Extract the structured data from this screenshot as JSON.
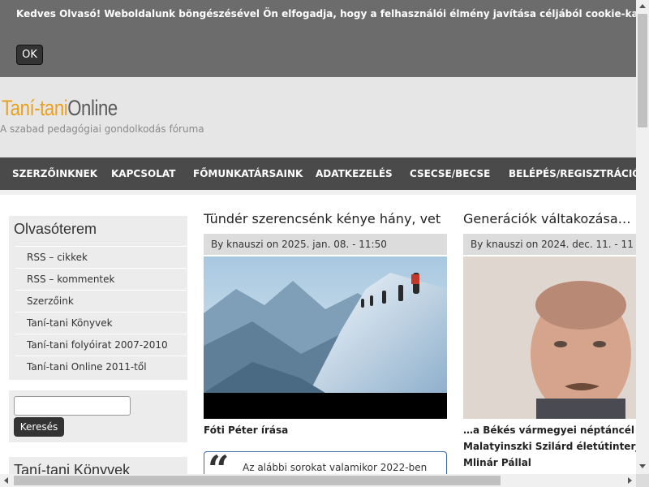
{
  "cookie_banner": {
    "text": "Kedves Olvasó! Weboldalunk böngészésével Ön elfogadja, hogy a felhasználói élmény javítása céljából cookie-kat használunk.",
    "ok_label": "OK"
  },
  "site": {
    "logo_part1": "Taní-tani",
    "logo_part2": "Online",
    "slogan": "A szabad pedagógiai gondolkodás fóruma"
  },
  "nav": {
    "items": [
      "SZERZŐINKNEK",
      "KAPCSOLAT",
      "FŐMUNKATÁRSAINK",
      "ADATKEZELÉS",
      "CSECSE/BECSE",
      "BELÉPÉS/REGISZTRÁCIÓ"
    ]
  },
  "sidebar": {
    "olvasoterem_title": "Olvasóterem",
    "links": [
      "RSS – cikkek",
      "RSS – kommentek",
      "Szerzőink",
      "Taní-tani Könyvek",
      "Taní-tani folyóirat 2007-2010",
      "Taní-tani Online 2011-től"
    ],
    "search_button": "Keresés",
    "books_title": "Taní-tani Könyvek"
  },
  "articles": [
    {
      "title": "Tündér szerencsénk kénye hány, vet",
      "meta": "By knauszi on 2025. jan. 08. - 11:50",
      "subtitle": "Fóti Péter írása",
      "quote_start": "Az alábbi sorokat valamikor 2022-ben"
    },
    {
      "title": "Generációk váltakozása…",
      "meta": "By knauszi on 2024. dec. 11. - 11",
      "subtitle_lines": [
        "…a Békés vármegyei néptáncél",
        "Malatyinszki Szilárd életútinterj",
        "Mlinár Pállal"
      ]
    }
  ],
  "colors": {
    "cookie_bg": "#6c6c6c",
    "logo_accent": "#e8a020",
    "nav_bg": "#4a4a4a"
  }
}
